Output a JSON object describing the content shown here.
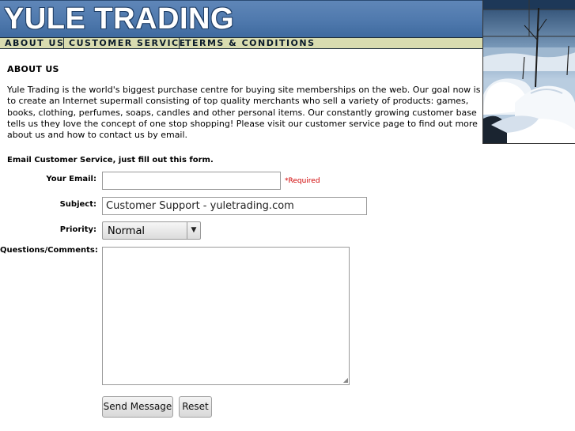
{
  "header": {
    "logo_text": "YULE TRADING",
    "nav": [
      "ABOUT US",
      "CUSTOMER SERVICE",
      "TERMS & CONDITIONS"
    ]
  },
  "about": {
    "title": "ABOUT US",
    "body": "Yule Trading is the world's biggest purchase centre for buying site memberships on the web. Our goal now is to create an Internet supermall consisting of top quality merchants who sell a variety of products: games, books, clothing, perfumes, soaps, candles and other personal items. Our constantly growing customer base tells us they love the concept of one stop shopping! Please visit our customer service page to find out more about us and how to contact us by email."
  },
  "form": {
    "intro": "Email Customer Service, just fill out this form.",
    "email_label": "Your Email:",
    "email_value": "",
    "required_note": "*Required",
    "subject_label": "Subject:",
    "subject_value": "Customer Support - yuletrading.com",
    "priority_label": "Priority:",
    "priority_value": "Normal",
    "comments_label": "Questions/Comments:",
    "send_label": "Send Message",
    "reset_label": "Reset"
  },
  "icons": {
    "dropdown": "chevron-down-icon",
    "resize": "resize-grip-icon",
    "photo": "winter-landscape-image"
  },
  "colors": {
    "header_blue": "#4f79ad",
    "nav_bg": "#d9dcb0",
    "required_red": "#d00000"
  }
}
